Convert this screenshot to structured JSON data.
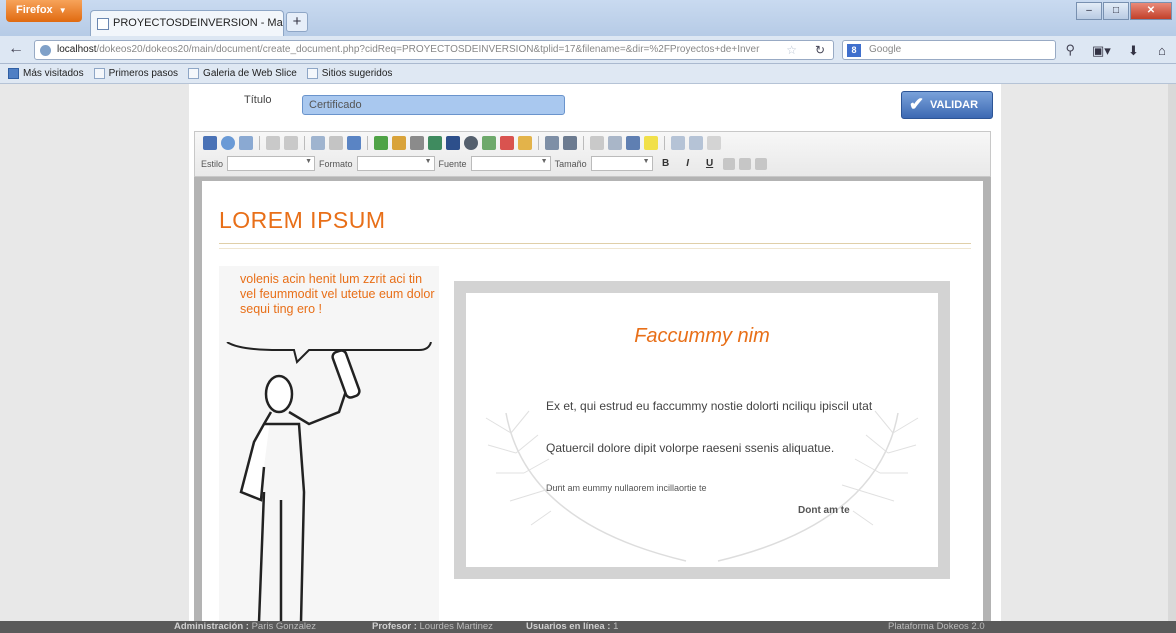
{
  "browser": {
    "app_button": "Firefox",
    "tab_title": "PROYECTOSDEINVERSION - Maestria en ...",
    "new_tab": "+",
    "url_host": "localhost",
    "url_rest": "/dokeos20/dokeos20/main/document/create_document.php?cidReq=PROYECTOSDEINVERSION&tplid=17&filename=&dir=%2FProyectos+de+Inver",
    "search_placeholder": "Google"
  },
  "bookmarks": [
    "Más visitados",
    "Primeros pasos",
    "Galeria de Web Slice",
    "Sitios sugeridos"
  ],
  "form": {
    "title_label": "Título",
    "title_value": "Certificado",
    "validate_button": "VALIDAR"
  },
  "toolbar": {
    "style_label": "Estilo",
    "format_label": "Formato",
    "font_label": "Fuente",
    "size_label": "Tamaño",
    "bold": "B",
    "italic": "I",
    "underline": "U"
  },
  "document": {
    "heading": "LOREM IPSUM",
    "bubble_text": "volenis acin henit lum zzrit aci tin vel feummodit vel utetue eum dolor sequi ting ero !",
    "certificate": {
      "title": "Faccummy nim",
      "paragraph1": "Ex et, qui estrud eu faccummy nostie dolorti nciliqu ipiscil utat",
      "paragraph2": "Qatuercil dolore dipit volorpe raeseni ssenis aliquatue.",
      "small_text": "Dunt am eummy nullaorem incillaortie te",
      "signature": "Dont am te"
    }
  },
  "statusbar": {
    "admin_label": "Administración :",
    "admin_name": "Paris Gonzalez",
    "teacher_label": "Profesor :",
    "teacher_name": "Lourdes Martinez",
    "online_label": "Usuarios en línea :",
    "online_count": "1",
    "platform": "Plataforma Dokeos 2.0"
  },
  "colors": {
    "accent_orange": "#e86f18",
    "validate_blue": "#3c69b3",
    "title_input": "#a9c8ef"
  }
}
